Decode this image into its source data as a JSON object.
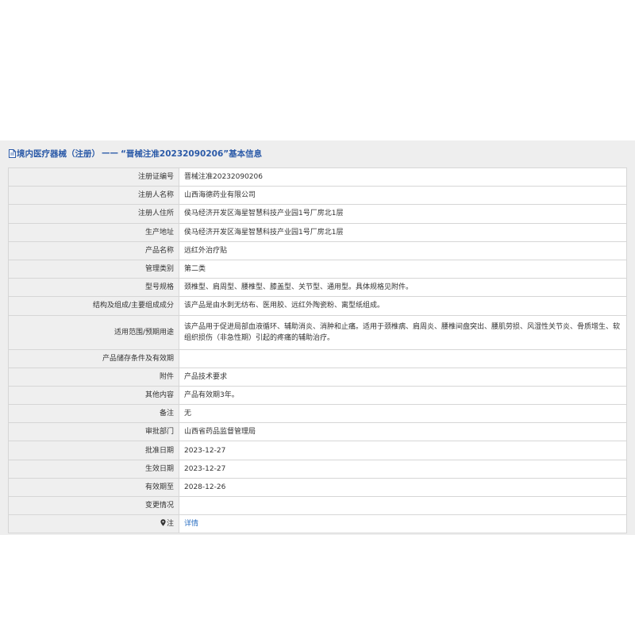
{
  "header": {
    "icon": "document-icon",
    "category": "境内医疗器械（注册）",
    "separator": "——",
    "record_title": "“晋械注准20232090206”基本信息"
  },
  "rows": [
    {
      "label": "注册证编号",
      "value": "晋械注准20232090206"
    },
    {
      "label": "注册人名称",
      "value": "山西海德药业有限公司"
    },
    {
      "label": "注册人住所",
      "value": "侯马经济开发区海星智慧科技产业园1号厂房北1层"
    },
    {
      "label": "生产地址",
      "value": "侯马经济开发区海星智慧科技产业园1号厂房北1层"
    },
    {
      "label": "产品名称",
      "value": "远红外治疗贴"
    },
    {
      "label": "管理类别",
      "value": "第二类"
    },
    {
      "label": "型号规格",
      "value": "颈椎型、肩周型、腰椎型、膝盖型、关节型、通用型。具体规格见附件。"
    },
    {
      "label": "结构及组成/主要组成成分",
      "value": "该产品是由水刺无纺布、医用胶、远红外陶瓷粉、离型纸组成。"
    },
    {
      "label": "适用范围/预期用途",
      "value": "该产品用于促进局部血液循环、辅助消炎、消肿和止痛。适用于颈椎病、肩周炎、腰椎间盘突出、腰肌劳损、风湿性关节炎、骨质增生、软组织损伤（非急性期）引起的疼痛的辅助治疗。"
    },
    {
      "label": "产品储存条件及有效期",
      "value": ""
    },
    {
      "label": "附件",
      "value": "产品技术要求"
    },
    {
      "label": "其他内容",
      "value": "产品有效期3年。"
    },
    {
      "label": "备注",
      "value": "无"
    },
    {
      "label": "审批部门",
      "value": "山西省药品监督管理局"
    },
    {
      "label": "批准日期",
      "value": "2023-12-27"
    },
    {
      "label": "生效日期",
      "value": "2023-12-27"
    },
    {
      "label": "有效期至",
      "value": "2028-12-26"
    },
    {
      "label": "变更情况",
      "value": ""
    },
    {
      "label": "注",
      "label_icon": "pin-icon",
      "value": "详情",
      "value_is_link": true
    }
  ]
}
